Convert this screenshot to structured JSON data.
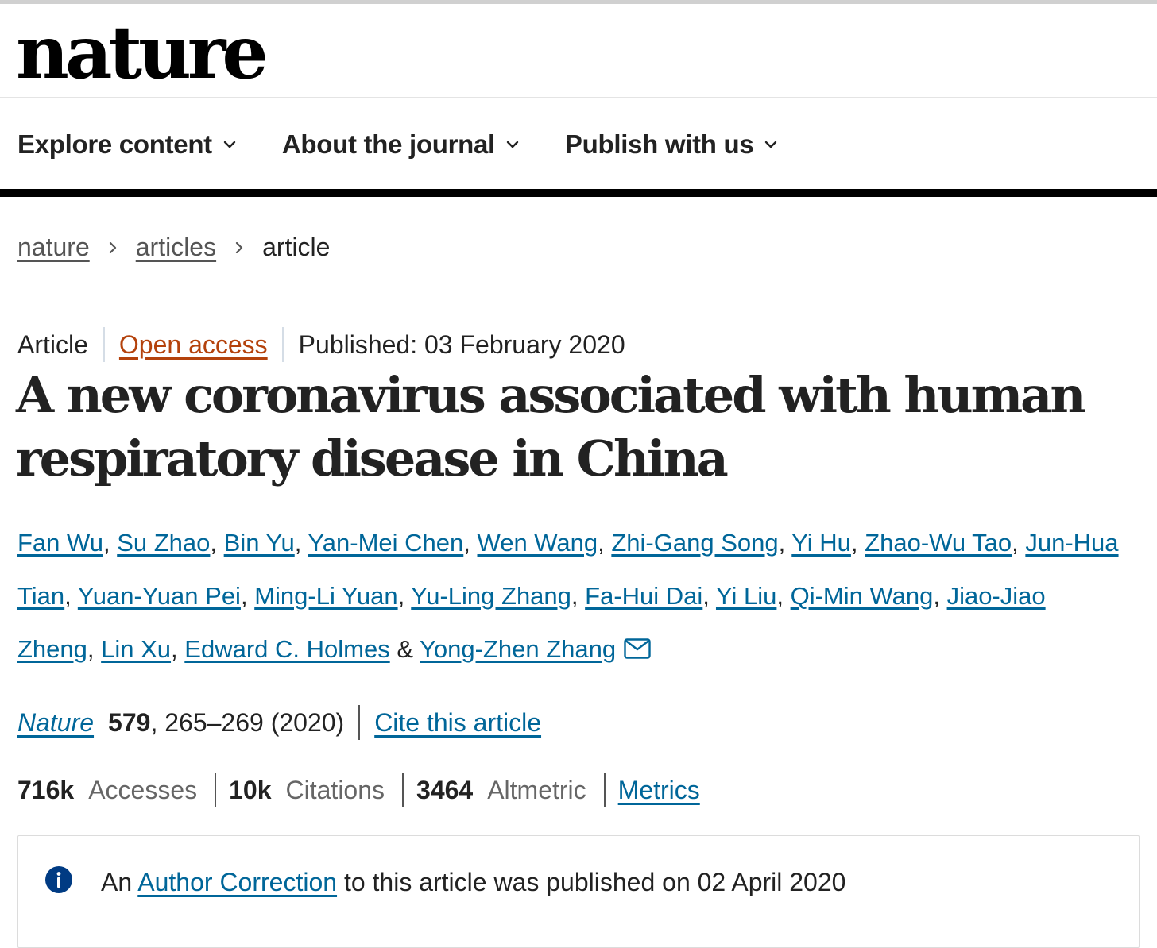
{
  "brand": {
    "logo": "nature"
  },
  "nav": {
    "items": [
      {
        "label": "Explore content"
      },
      {
        "label": "About the journal"
      },
      {
        "label": "Publish with us"
      }
    ]
  },
  "breadcrumb": {
    "items": [
      "nature",
      "articles"
    ],
    "current": "article"
  },
  "article": {
    "type": "Article",
    "access": "Open access",
    "published": "Published: 03 February 2020",
    "title": "A new coronavirus associated with human respiratory disease in China",
    "authors": [
      "Fan Wu",
      "Su Zhao",
      "Bin Yu",
      "Yan-Mei Chen",
      "Wen Wang",
      "Zhi-Gang Song",
      "Yi Hu",
      "Zhao-Wu Tao",
      "Jun-Hua Tian",
      "Yuan-Yuan Pei",
      "Ming-Li Yuan",
      "Yu-Ling Zhang",
      "Fa-Hui Dai",
      "Yi Liu",
      "Qi-Min Wang",
      "Jiao-Jiao Zheng",
      "Lin Xu",
      "Edward C. Holmes",
      "Yong-Zhen Zhang"
    ],
    "author_separator": ", ",
    "author_last_separator": " & ",
    "citation": {
      "journal": "Nature",
      "volume": "579",
      "pages_year": ", 265–269 (2020)",
      "cite_link": "Cite this article"
    },
    "metrics": {
      "accesses_value": "716k",
      "accesses_label": "Accesses",
      "citations_value": "10k",
      "citations_label": "Citations",
      "altmetric_value": "3464",
      "altmetric_label": "Altmetric",
      "metrics_link": "Metrics"
    },
    "notice": {
      "prefix": "An",
      "link": "Author Correction",
      "suffix": "to this article was published on 02 April 2020"
    }
  },
  "colors": {
    "link": "#006699",
    "open_access": "#b4420c",
    "info_icon": "#003b83"
  }
}
